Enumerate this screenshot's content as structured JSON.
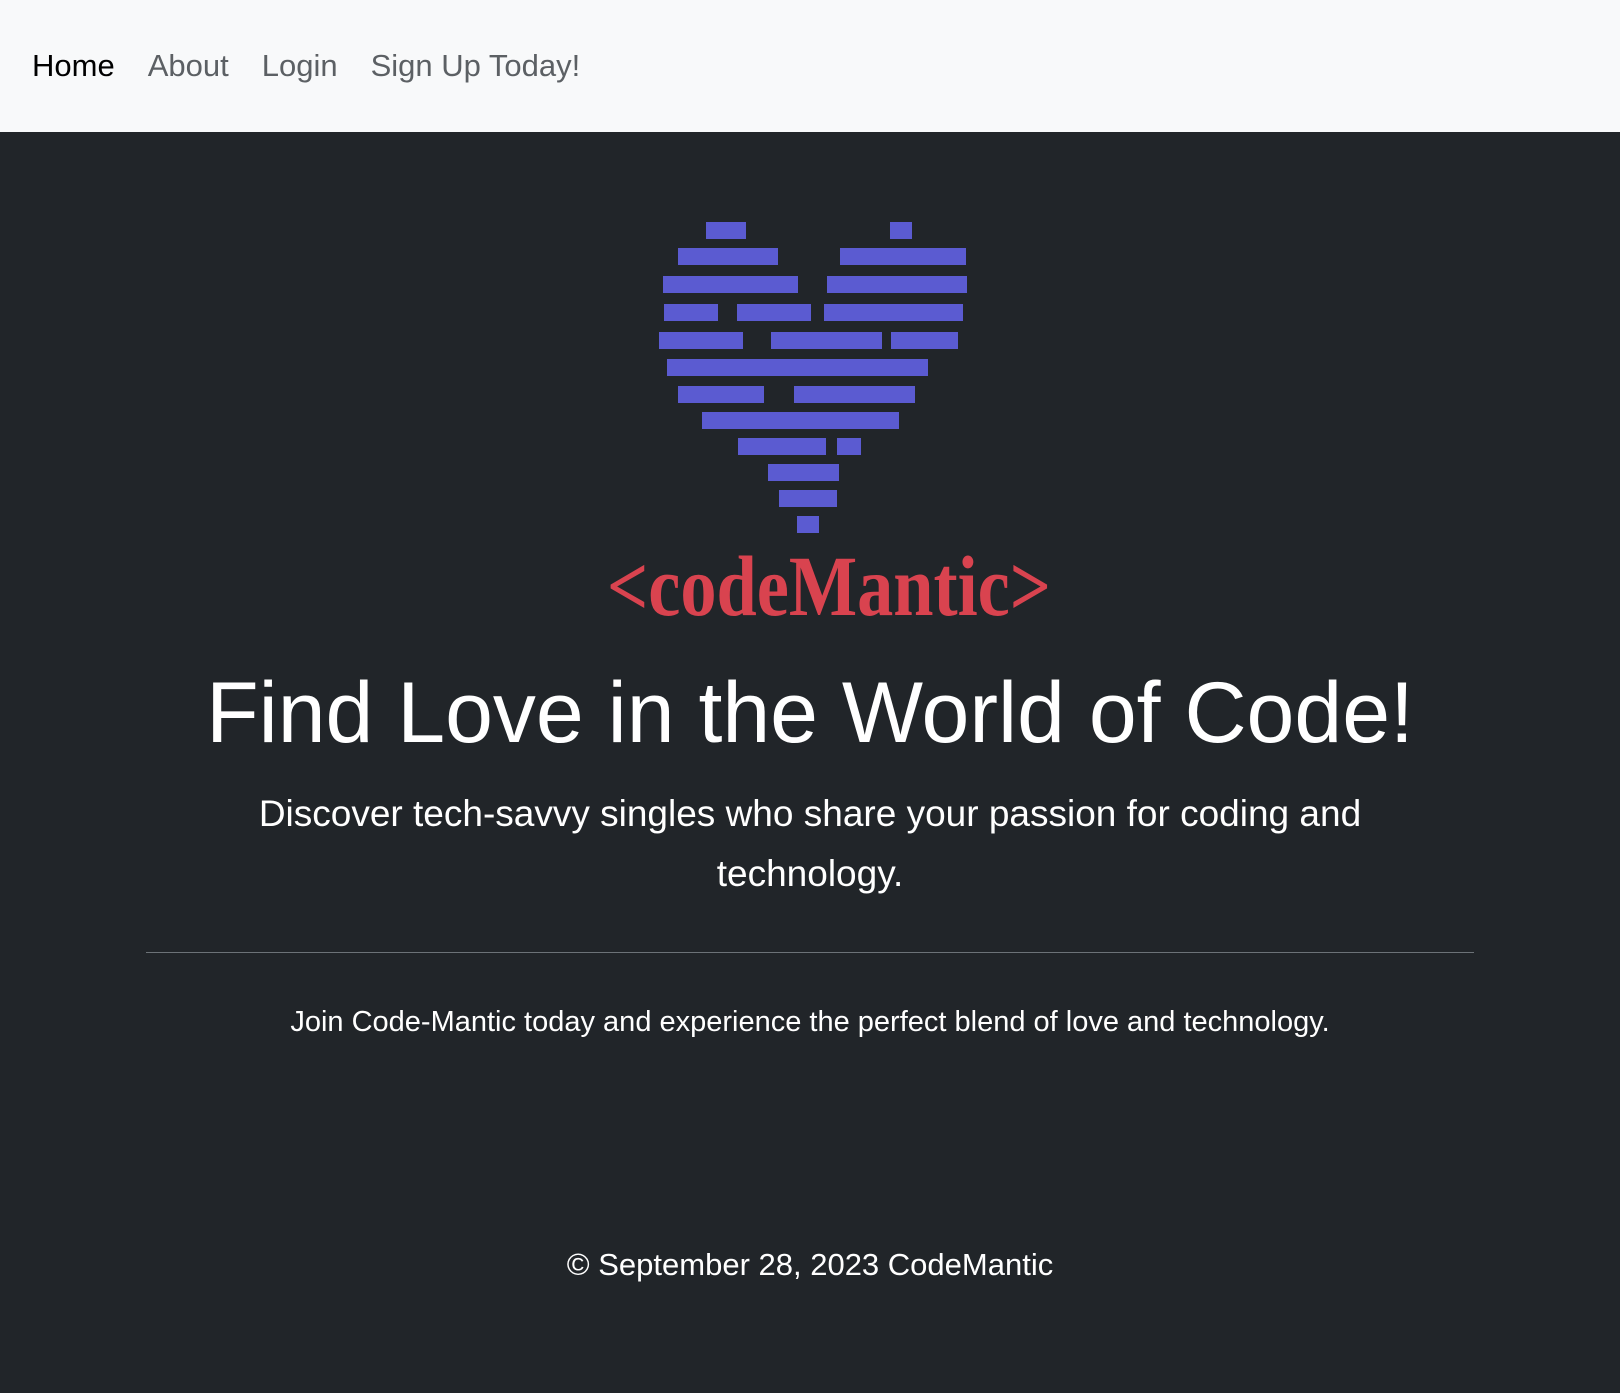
{
  "nav": {
    "items": [
      {
        "label": "Home",
        "active": true
      },
      {
        "label": "About",
        "active": false
      },
      {
        "label": "Login",
        "active": false
      },
      {
        "label": "Sign Up Today!",
        "active": false
      }
    ]
  },
  "logo": {
    "icon": "pixel-heart-icon",
    "wordmark": "<codeMantic>",
    "heart_color": "#5b5bd1",
    "wordmark_color": "#d9434f"
  },
  "hero": {
    "title": "Find Love in the World of Code!",
    "lead": "Discover tech-savvy singles who share your passion for coding and technology.",
    "join_text": "Join Code-Mantic today and experience the perfect blend of love and technology."
  },
  "footer": {
    "copyright": "© September 28, 2023 CodeMantic"
  },
  "colors": {
    "navbar_bg": "#f8f9fa",
    "page_bg": "#212529",
    "text": "#ffffff"
  }
}
